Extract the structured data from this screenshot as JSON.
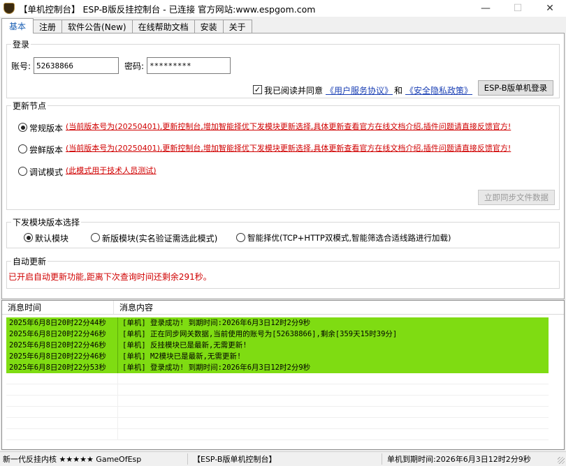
{
  "window": {
    "title": "【单机控制台】 ESP-B版反挂控制台 - 已连接    官方网站:www.espgom.com",
    "minimize": "—",
    "maximize": "☐",
    "close": "✕"
  },
  "tabs": [
    {
      "label": "基本",
      "active": true
    },
    {
      "label": "注册"
    },
    {
      "label": "软件公告(New)"
    },
    {
      "label": "在线帮助文档"
    },
    {
      "label": "安装"
    },
    {
      "label": "关于"
    }
  ],
  "login": {
    "group_title": "登录",
    "account_label": "账号:",
    "account_value": "52638866",
    "password_label": "密码:",
    "password_value": "*********",
    "agree_checked": true,
    "agree_text": "我已阅读并同意",
    "terms_link": "《用户服务协议》",
    "and_text": "和",
    "privacy_link": "《安全隐私政策》",
    "login_button": "ESP-B版单机登录"
  },
  "update_node": {
    "group_title": "更新节点",
    "options": [
      {
        "label": "常规版本",
        "note": "(当前版本号为(20250401),更新控制台,增加智能择优下发模块更新选择,具体更新查看官方在线文档介绍,插件问题请直接反馈官方!",
        "checked": true
      },
      {
        "label": "尝鲜版本",
        "note": "(当前版本号为(20250401),更新控制台,增加智能择优下发模块更新选择,具体更新查看官方在线文档介绍,插件问题请直接反馈官方!",
        "checked": false
      },
      {
        "label": "调试模式",
        "note": "(此模式用于技术人员测试)",
        "checked": false
      }
    ],
    "sync_button": "立即同步文件数据"
  },
  "module_select": {
    "group_title": "下发模块版本选择",
    "options": [
      {
        "label": "默认模块",
        "checked": true
      },
      {
        "label": "新版模块(实名验证需选此模式)",
        "checked": false
      },
      {
        "label": "智能择优(TCP+HTTP双模式,智能筛选合适线路进行加载)",
        "checked": false
      }
    ]
  },
  "auto_update": {
    "group_title": "自动更新",
    "message": "已开启自动更新功能,距离下次查询时间还剩余291秒。"
  },
  "log": {
    "headers": [
      "消息时间",
      "消息内容"
    ],
    "rows": [
      {
        "time": "2025年6月8日20时22分44秒",
        "content": "[单机] 登录成功! 到期时间:2026年6月3日12时2分9秒"
      },
      {
        "time": "2025年6月8日20时22分46秒",
        "content": "[单机] 正在同步网关数据,当前使用的账号为[52638866],剩余[359天15时39分]"
      },
      {
        "time": "2025年6月8日20时22分46秒",
        "content": "[单机] 反挂模块已是最新,无需更新!"
      },
      {
        "time": "2025年6月8日20时22分46秒",
        "content": "[单机] M2模块已是最新,无需更新!"
      },
      {
        "time": "2025年6月8日20时22分53秒",
        "content": "[单机] 登录成功! 到期时间:2026年6月3日12时2分9秒"
      }
    ],
    "row_color": "#7fdc12"
  },
  "statusbar": {
    "left": "新一代反挂内核 ★★★★★ GameOfEsp",
    "middle": "【ESP-B版单机控制台】",
    "right": "单机到期时间:2026年6月3日12时2分9秒"
  },
  "colors": {
    "accent": "#1a5fb4",
    "notice_red": "#d00000",
    "log_green": "#7fdc12"
  }
}
